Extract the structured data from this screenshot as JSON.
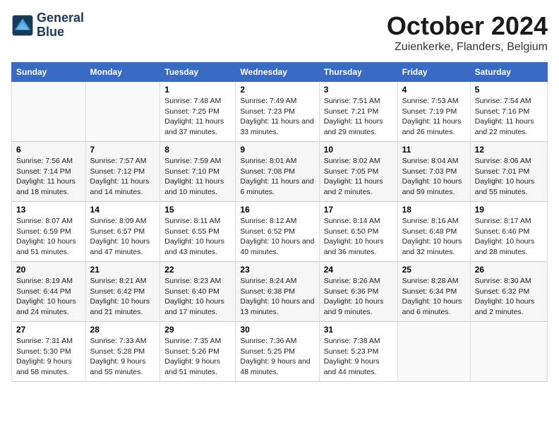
{
  "logo": {
    "line1": "General",
    "line2": "Blue"
  },
  "title": "October 2024",
  "subtitle": "Zuienkerke, Flanders, Belgium",
  "weekdays": [
    "Sunday",
    "Monday",
    "Tuesday",
    "Wednesday",
    "Thursday",
    "Friday",
    "Saturday"
  ],
  "weeks": [
    [
      {
        "day": "",
        "sunrise": "",
        "sunset": "",
        "daylight": ""
      },
      {
        "day": "",
        "sunrise": "",
        "sunset": "",
        "daylight": ""
      },
      {
        "day": "1",
        "sunrise": "Sunrise: 7:48 AM",
        "sunset": "Sunset: 7:25 PM",
        "daylight": "Daylight: 11 hours and 37 minutes."
      },
      {
        "day": "2",
        "sunrise": "Sunrise: 7:49 AM",
        "sunset": "Sunset: 7:23 PM",
        "daylight": "Daylight: 11 hours and 33 minutes."
      },
      {
        "day": "3",
        "sunrise": "Sunrise: 7:51 AM",
        "sunset": "Sunset: 7:21 PM",
        "daylight": "Daylight: 11 hours and 29 minutes."
      },
      {
        "day": "4",
        "sunrise": "Sunrise: 7:53 AM",
        "sunset": "Sunset: 7:19 PM",
        "daylight": "Daylight: 11 hours and 26 minutes."
      },
      {
        "day": "5",
        "sunrise": "Sunrise: 7:54 AM",
        "sunset": "Sunset: 7:16 PM",
        "daylight": "Daylight: 11 hours and 22 minutes."
      }
    ],
    [
      {
        "day": "6",
        "sunrise": "Sunrise: 7:56 AM",
        "sunset": "Sunset: 7:14 PM",
        "daylight": "Daylight: 11 hours and 18 minutes."
      },
      {
        "day": "7",
        "sunrise": "Sunrise: 7:57 AM",
        "sunset": "Sunset: 7:12 PM",
        "daylight": "Daylight: 11 hours and 14 minutes."
      },
      {
        "day": "8",
        "sunrise": "Sunrise: 7:59 AM",
        "sunset": "Sunset: 7:10 PM",
        "daylight": "Daylight: 11 hours and 10 minutes."
      },
      {
        "day": "9",
        "sunrise": "Sunrise: 8:01 AM",
        "sunset": "Sunset: 7:08 PM",
        "daylight": "Daylight: 11 hours and 6 minutes."
      },
      {
        "day": "10",
        "sunrise": "Sunrise: 8:02 AM",
        "sunset": "Sunset: 7:05 PM",
        "daylight": "Daylight: 11 hours and 2 minutes."
      },
      {
        "day": "11",
        "sunrise": "Sunrise: 8:04 AM",
        "sunset": "Sunset: 7:03 PM",
        "daylight": "Daylight: 10 hours and 59 minutes."
      },
      {
        "day": "12",
        "sunrise": "Sunrise: 8:06 AM",
        "sunset": "Sunset: 7:01 PM",
        "daylight": "Daylight: 10 hours and 55 minutes."
      }
    ],
    [
      {
        "day": "13",
        "sunrise": "Sunrise: 8:07 AM",
        "sunset": "Sunset: 6:59 PM",
        "daylight": "Daylight: 10 hours and 51 minutes."
      },
      {
        "day": "14",
        "sunrise": "Sunrise: 8:09 AM",
        "sunset": "Sunset: 6:57 PM",
        "daylight": "Daylight: 10 hours and 47 minutes."
      },
      {
        "day": "15",
        "sunrise": "Sunrise: 8:11 AM",
        "sunset": "Sunset: 6:55 PM",
        "daylight": "Daylight: 10 hours and 43 minutes."
      },
      {
        "day": "16",
        "sunrise": "Sunrise: 8:12 AM",
        "sunset": "Sunset: 6:52 PM",
        "daylight": "Daylight: 10 hours and 40 minutes."
      },
      {
        "day": "17",
        "sunrise": "Sunrise: 8:14 AM",
        "sunset": "Sunset: 6:50 PM",
        "daylight": "Daylight: 10 hours and 36 minutes."
      },
      {
        "day": "18",
        "sunrise": "Sunrise: 8:16 AM",
        "sunset": "Sunset: 6:48 PM",
        "daylight": "Daylight: 10 hours and 32 minutes."
      },
      {
        "day": "19",
        "sunrise": "Sunrise: 8:17 AM",
        "sunset": "Sunset: 6:46 PM",
        "daylight": "Daylight: 10 hours and 28 minutes."
      }
    ],
    [
      {
        "day": "20",
        "sunrise": "Sunrise: 8:19 AM",
        "sunset": "Sunset: 6:44 PM",
        "daylight": "Daylight: 10 hours and 24 minutes."
      },
      {
        "day": "21",
        "sunrise": "Sunrise: 8:21 AM",
        "sunset": "Sunset: 6:42 PM",
        "daylight": "Daylight: 10 hours and 21 minutes."
      },
      {
        "day": "22",
        "sunrise": "Sunrise: 8:23 AM",
        "sunset": "Sunset: 6:40 PM",
        "daylight": "Daylight: 10 hours and 17 minutes."
      },
      {
        "day": "23",
        "sunrise": "Sunrise: 8:24 AM",
        "sunset": "Sunset: 6:38 PM",
        "daylight": "Daylight: 10 hours and 13 minutes."
      },
      {
        "day": "24",
        "sunrise": "Sunrise: 8:26 AM",
        "sunset": "Sunset: 6:36 PM",
        "daylight": "Daylight: 10 hours and 9 minutes."
      },
      {
        "day": "25",
        "sunrise": "Sunrise: 8:28 AM",
        "sunset": "Sunset: 6:34 PM",
        "daylight": "Daylight: 10 hours and 6 minutes."
      },
      {
        "day": "26",
        "sunrise": "Sunrise: 8:30 AM",
        "sunset": "Sunset: 6:32 PM",
        "daylight": "Daylight: 10 hours and 2 minutes."
      }
    ],
    [
      {
        "day": "27",
        "sunrise": "Sunrise: 7:31 AM",
        "sunset": "Sunset: 5:30 PM",
        "daylight": "Daylight: 9 hours and 58 minutes."
      },
      {
        "day": "28",
        "sunrise": "Sunrise: 7:33 AM",
        "sunset": "Sunset: 5:28 PM",
        "daylight": "Daylight: 9 hours and 55 minutes."
      },
      {
        "day": "29",
        "sunrise": "Sunrise: 7:35 AM",
        "sunset": "Sunset: 5:26 PM",
        "daylight": "Daylight: 9 hours and 51 minutes."
      },
      {
        "day": "30",
        "sunrise": "Sunrise: 7:36 AM",
        "sunset": "Sunset: 5:25 PM",
        "daylight": "Daylight: 9 hours and 48 minutes."
      },
      {
        "day": "31",
        "sunrise": "Sunrise: 7:38 AM",
        "sunset": "Sunset: 5:23 PM",
        "daylight": "Daylight: 9 hours and 44 minutes."
      },
      {
        "day": "",
        "sunrise": "",
        "sunset": "",
        "daylight": ""
      },
      {
        "day": "",
        "sunrise": "",
        "sunset": "",
        "daylight": ""
      }
    ]
  ]
}
